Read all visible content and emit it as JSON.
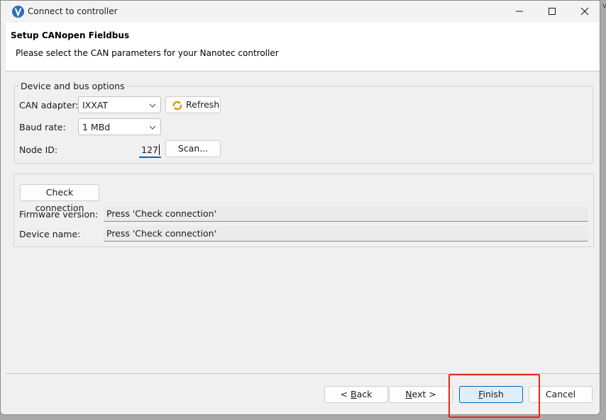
{
  "window": {
    "title": "Connect to controller"
  },
  "header": {
    "title": "Setup CANopen Fieldbus",
    "subtitle": "Please select the CAN parameters for your Nanotec controller"
  },
  "device_group": {
    "title": "Device and bus options",
    "can_adapter_label": "CAN adapter:",
    "can_adapter_value": "IXXAT",
    "refresh_label": "Refresh",
    "baud_rate_label": "Baud rate:",
    "baud_rate_value": "1 MBd",
    "node_id_label": "Node ID:",
    "node_id_value": "127",
    "scan_label": "Scan..."
  },
  "connection_group": {
    "check_label": "Check connection",
    "firmware_label": "Firmware version:",
    "firmware_value": "Press 'Check connection'",
    "device_name_label": "Device name:",
    "device_name_value": "Press 'Check connection'"
  },
  "footer": {
    "back_prefix": "< ",
    "back_mnemonic": "B",
    "back_rest": "ack",
    "next_mnemonic": "N",
    "next_rest": "ext >",
    "finish_mnemonic": "F",
    "finish_rest": "inish",
    "cancel_label": "Cancel"
  },
  "edge_glyph": "v",
  "colors": {
    "accent": "#0067c0",
    "highlight": "#e8261d",
    "finish_bg": "#e0eef9"
  },
  "icons": {
    "app": "nanotec-logo-icon",
    "refresh": "refresh-icon",
    "minimize": "minimize-icon",
    "maximize": "maximize-icon",
    "close": "close-icon",
    "dropdown": "chevron-down-icon"
  }
}
